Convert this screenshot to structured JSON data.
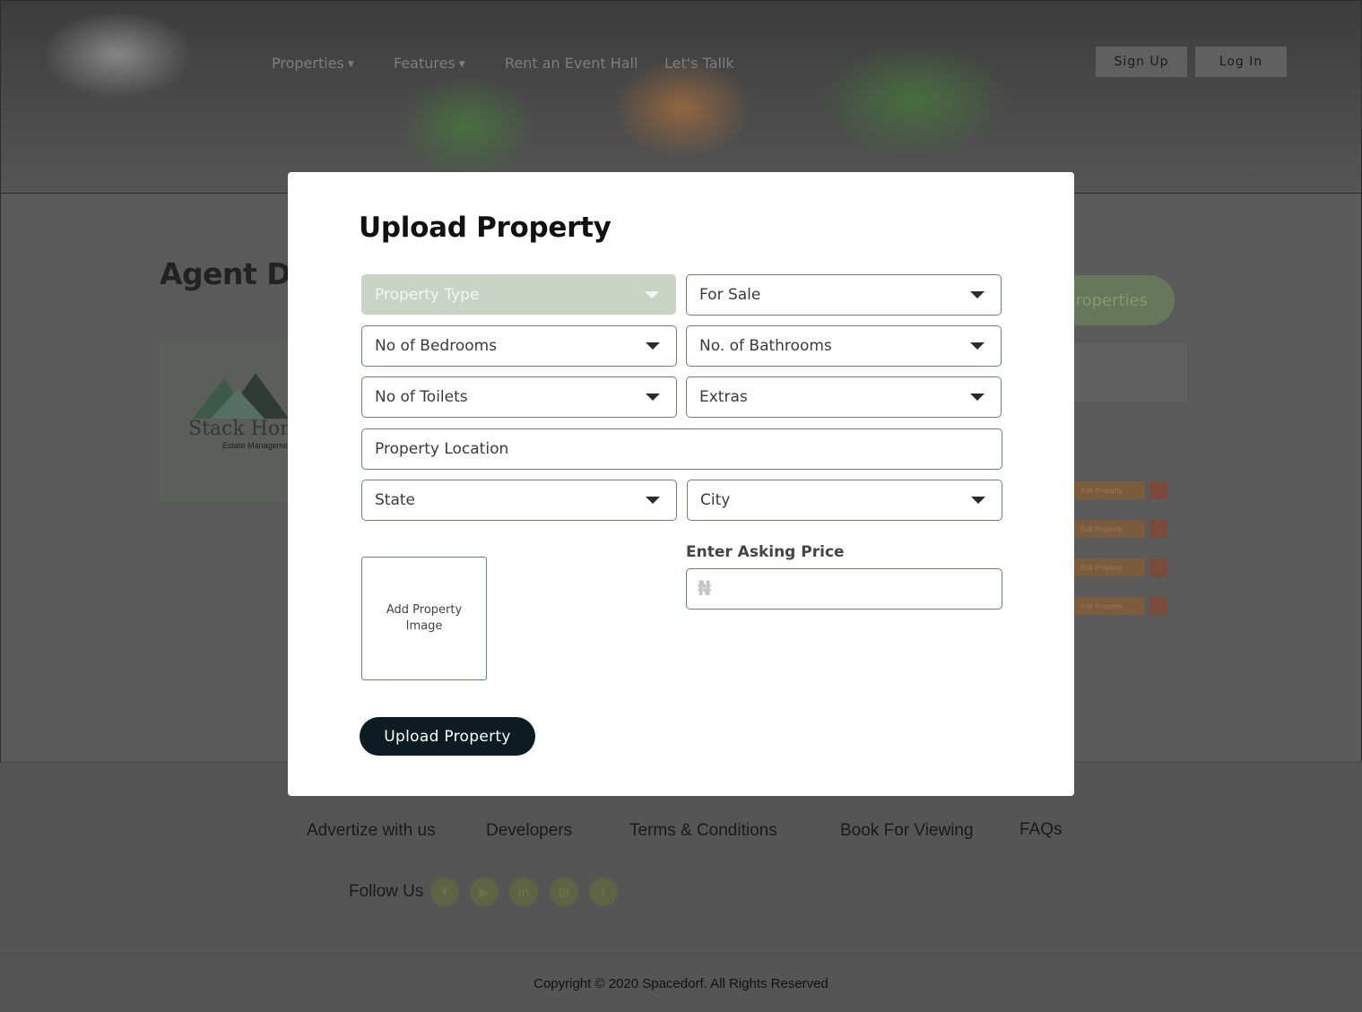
{
  "header": {
    "nav": [
      {
        "label": "Properties",
        "has_caret": true
      },
      {
        "label": "Features",
        "has_caret": true
      },
      {
        "label": "Rent an Event Hall",
        "has_caret": false
      },
      {
        "label": "Let's Tallk",
        "has_caret": false
      }
    ],
    "signup_label": "Sign Up",
    "login_label": "Log In"
  },
  "dashboard": {
    "heading": "Agent Da",
    "logo_text": "Stack Home",
    "logo_sub": "Estate Management",
    "properties_button": "roperties",
    "row_action_label": "Edit Property"
  },
  "modal": {
    "title": "Upload Property",
    "fields": {
      "property_type": "Property Type",
      "for_sale": "For Sale",
      "bedrooms": "No of Bedrooms",
      "bathrooms": "No. of Bathrooms",
      "toilets": "No of Toilets",
      "extras": "Extras",
      "location": "Property Location",
      "state": "State",
      "city": "City"
    },
    "add_image_label": "Add Property Image",
    "price_label": "Enter Asking Price",
    "currency_symbol": "₦",
    "price_value": "",
    "submit_label": "Upload Property"
  },
  "footer": {
    "links": [
      "Advertize with us",
      "Developers",
      "Terms & Conditions",
      "Book For Viewing",
      "FAQs"
    ],
    "follow_label": "Follow Us",
    "social_icons": [
      "facebook-icon",
      "youtube-icon",
      "linkedin-icon",
      "instagram-icon",
      "twitter-icon"
    ],
    "copyright": "Copyright © 2020 Spacedorf. All Rights Reserved"
  },
  "colors": {
    "overlay": "#5a5a5a",
    "primary_dark": "#0c1c22",
    "field_border": "#6e8071",
    "filled_field": "#c9d3c6"
  }
}
